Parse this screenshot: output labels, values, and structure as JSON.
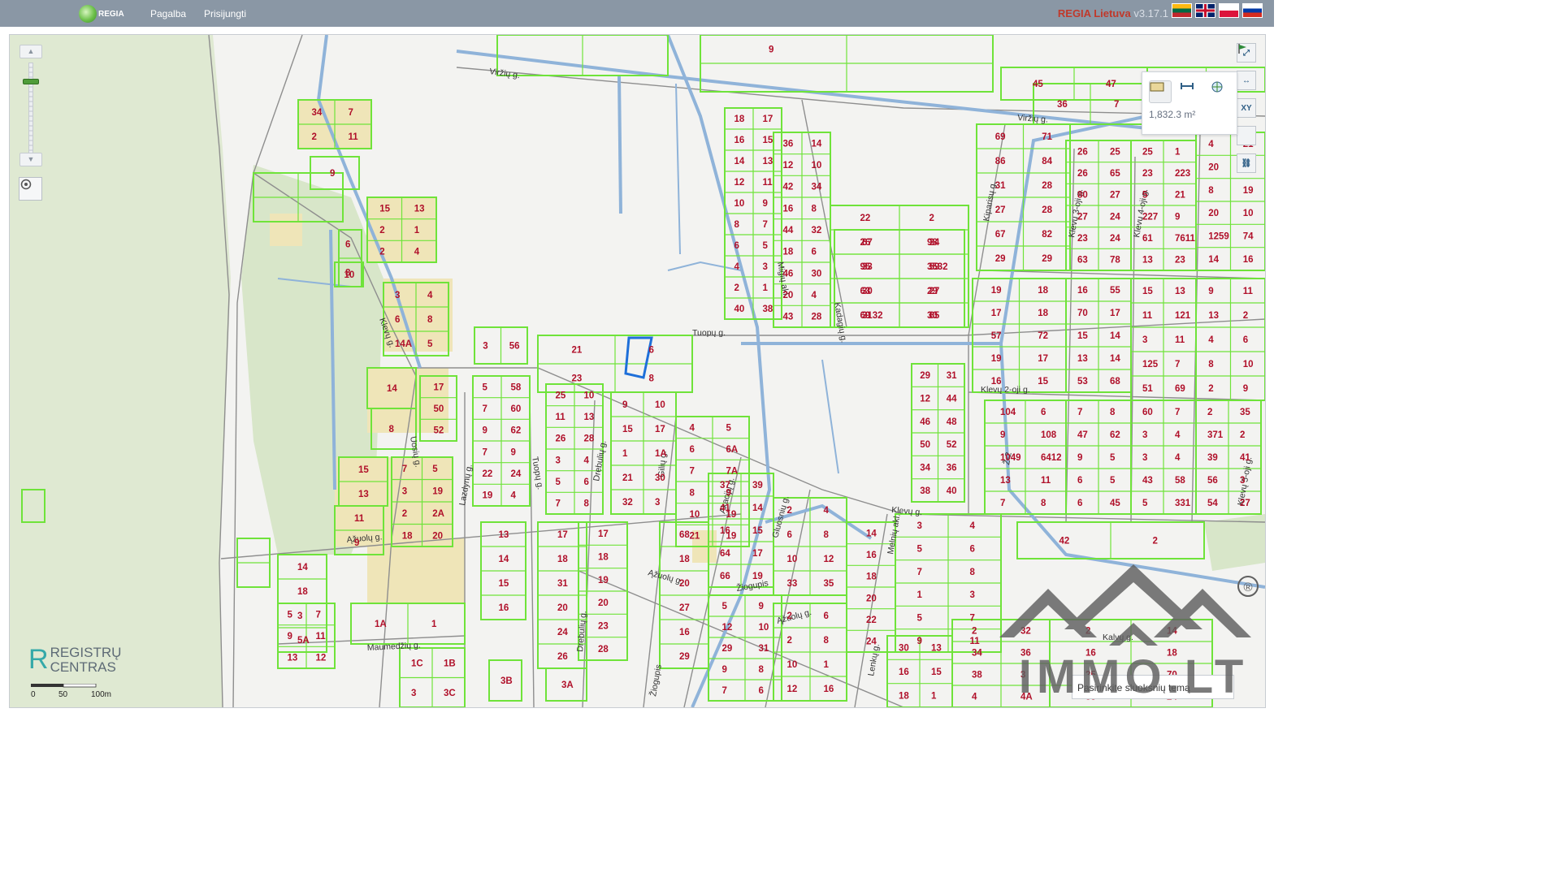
{
  "header": {
    "logo_text": "REGIA",
    "nav": [
      "Pagalba",
      "Prisijungti"
    ],
    "brand_name": "REGIA Lietuva",
    "brand_version": "v3.17.1",
    "flags": [
      "lithuanian-flag",
      "english-flag",
      "polish-flag",
      "russian-flag"
    ]
  },
  "map": {
    "streets": [
      "Viržių g.",
      "Viržių g.",
      "Tuopų g.",
      "Kadagių g.",
      "Migių akl.",
      "Kiparisų g.",
      "Klevų 3-oji g.",
      "Klevų 4-oji g.",
      "Klevų 2-oji g.",
      "Klevų g.",
      "Klevų g.",
      "Klevų 5-oji g.",
      "Uosių g.",
      "Lazdynų g.",
      "Tuopų g.",
      "Drebulių g.",
      "Gilių g.",
      "Akacijų g.",
      "Gluosnių g.",
      "Žiogupis",
      "Žiogupis",
      "Ąžuolų g.",
      "Ąžuolų g.",
      "Ąžuolų g.",
      "Drebulių g.",
      "Maumedžių g.",
      "Melnių akl.",
      "Lenkų g.",
      "Ž-2",
      "Kalvų g."
    ],
    "lot_numbers": [
      "34",
      "7",
      "2",
      "11",
      "9",
      "6",
      "8",
      "10",
      "15",
      "13",
      "2",
      "1",
      "2",
      "4",
      "3",
      "4",
      "6",
      "8",
      "14A",
      "5",
      "14",
      "8",
      "17",
      "50",
      "52",
      "15",
      "13",
      "11",
      "9",
      "7",
      "5",
      "3",
      "19",
      "2",
      "2A",
      "18",
      "20",
      "3",
      "56",
      "5",
      "58",
      "7",
      "60",
      "9",
      "62",
      "7",
      "9",
      "22",
      "24",
      "19",
      "4",
      "21",
      "6",
      "23",
      "8",
      "25",
      "10",
      "11",
      "13",
      "26",
      "28",
      "3",
      "4",
      "5",
      "6",
      "7",
      "8",
      "9",
      "10",
      "15",
      "17",
      "1",
      "1A",
      "21",
      "30",
      "32",
      "3",
      "4",
      "5",
      "6",
      "6A",
      "7",
      "7A",
      "8",
      "9",
      "10",
      "19",
      "21",
      "19",
      "18",
      "17",
      "16",
      "15",
      "14",
      "13",
      "12",
      "11",
      "10",
      "9",
      "8",
      "7",
      "6",
      "5",
      "4",
      "3",
      "2",
      "1",
      "40",
      "38",
      "36",
      "14",
      "12",
      "10",
      "42",
      "34",
      "16",
      "8",
      "44",
      "32",
      "18",
      "6",
      "46",
      "30",
      "20",
      "4",
      "43",
      "28",
      "22",
      "2",
      "26",
      "24",
      "95",
      "59",
      "63",
      "27",
      "69",
      "65",
      "67",
      "98",
      "33",
      "3532",
      "30",
      "29",
      "3132",
      "30",
      "69",
      "71",
      "86",
      "84",
      "31",
      "28",
      "27",
      "28",
      "67",
      "82",
      "29",
      "29",
      "26",
      "25",
      "26",
      "65",
      "80",
      "27",
      "27",
      "24",
      "23",
      "24",
      "63",
      "78",
      "25",
      "1",
      "23",
      "223",
      "5",
      "21",
      "227",
      "9",
      "61",
      "7611",
      "13",
      "23",
      "4",
      "21",
      "20",
      "6",
      "8",
      "19",
      "20",
      "10",
      "1259",
      "74",
      "14",
      "16",
      "19",
      "18",
      "17",
      "18",
      "57",
      "72",
      "19",
      "17",
      "16",
      "15",
      "16",
      "55",
      "70",
      "17",
      "15",
      "14",
      "13",
      "14",
      "53",
      "68",
      "15",
      "13",
      "11",
      "121",
      "3",
      "11",
      "125",
      "7",
      "51",
      "69",
      "9",
      "11",
      "13",
      "2",
      "4",
      "6",
      "8",
      "10",
      "2",
      "9",
      "104",
      "6",
      "9",
      "108",
      "1049",
      "6412",
      "13",
      "11",
      "7",
      "8",
      "7",
      "8",
      "47",
      "62",
      "9",
      "5",
      "6",
      "5",
      "6",
      "45",
      "60",
      "7",
      "3",
      "4",
      "3",
      "4",
      "43",
      "58",
      "5",
      "331",
      "2",
      "35",
      "371",
      "2",
      "39",
      "41",
      "56",
      "3",
      "54",
      "27",
      "29",
      "31",
      "12",
      "44",
      "46",
      "48",
      "50",
      "52",
      "34",
      "36",
      "38",
      "40",
      "42",
      "2",
      "3",
      "4",
      "5",
      "6",
      "7",
      "8",
      "1",
      "3",
      "5",
      "7",
      "9",
      "11",
      "14",
      "16",
      "18",
      "20",
      "22",
      "24",
      "2",
      "4",
      "6",
      "8",
      "10",
      "12",
      "33",
      "35",
      "37",
      "39",
      "41",
      "14",
      "16",
      "15",
      "64",
      "17",
      "66",
      "19",
      "68",
      "18",
      "20",
      "27",
      "16",
      "29",
      "17",
      "18",
      "31",
      "20",
      "24",
      "26",
      "13",
      "14",
      "15",
      "16",
      "17",
      "18",
      "19",
      "20",
      "23",
      "28",
      "30",
      "13",
      "16",
      "15",
      "18",
      "1",
      "2",
      "32",
      "34",
      "36",
      "38",
      "3",
      "4",
      "4A",
      "5",
      "9",
      "12",
      "10",
      "29",
      "31",
      "9",
      "8",
      "7",
      "6",
      "2",
      "6",
      "2",
      "8",
      "10",
      "1",
      "12",
      "16",
      "14",
      "18",
      "3",
      "5A",
      "5",
      "7",
      "9",
      "11",
      "13",
      "12",
      "1A",
      "1",
      "1C",
      "1B",
      "3",
      "3C",
      "3B",
      "3A",
      "2",
      "14",
      "16",
      "18",
      "25",
      "70",
      "33",
      "24",
      "30",
      "40",
      "45",
      "47",
      "36",
      "7",
      "9"
    ],
    "scale_labels": [
      "0",
      "50",
      "100m"
    ],
    "registru_line1": "REGISTRŲ",
    "registru_line2": "CENTRAS",
    "theme_placeholder": "Pasirinkite sluoksnių temą"
  },
  "measure_panel": {
    "area_value": "1,832.3 m²",
    "tools": [
      "area-measure-icon",
      "distance-measure-icon",
      "point-measure-icon"
    ]
  },
  "right_toolbar": [
    "full-extent-icon",
    "measure-icon",
    "xy-coordinates-icon",
    "flag-icon",
    "link-icon"
  ],
  "watermark": {
    "text": "IMMO.LT",
    "registered_mark": "®"
  },
  "colors": {
    "topbar": "#8a97a5",
    "parcel_outline": "#6fe33a",
    "lot_label": "#b0102a",
    "water": "#8fb3d9",
    "selected_parcel": "#1e6fd9",
    "brand_red": "#c0392b"
  }
}
